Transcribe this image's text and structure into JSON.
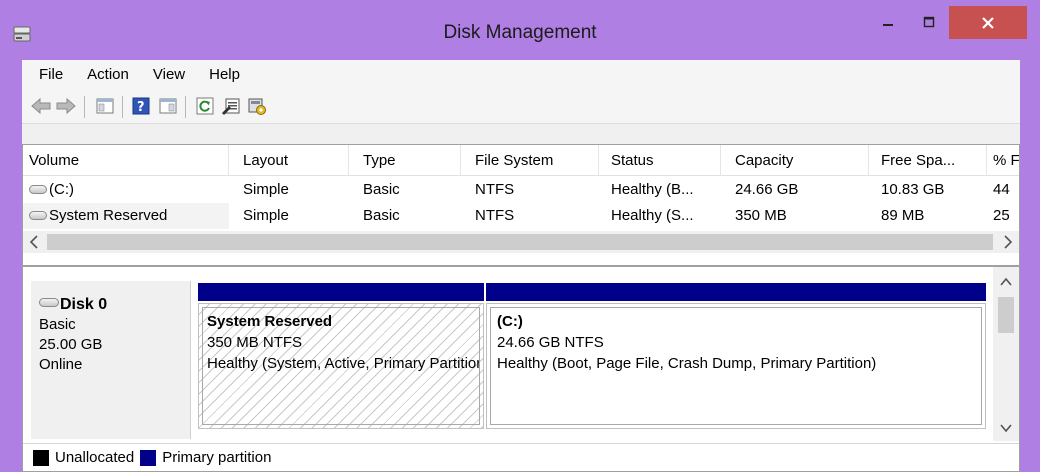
{
  "window": {
    "title": "Disk Management",
    "titlebar_color": "#b07fe3",
    "close_color": "#c75050"
  },
  "menu": [
    "File",
    "Action",
    "View",
    "Help"
  ],
  "toolbar": {
    "icons": [
      "back-arrow-icon",
      "forward-arrow-icon",
      "show-hide-console-tree-icon",
      "help-icon",
      "show-hide-action-pane-icon",
      "refresh-icon",
      "properties-icon",
      "disk-settings-icon"
    ]
  },
  "volume_list": {
    "columns": [
      "Volume",
      "Layout",
      "Type",
      "File System",
      "Status",
      "Capacity",
      "Free Spa...",
      "% F"
    ],
    "rows": [
      [
        "(C:)",
        "Simple",
        "Basic",
        "NTFS",
        "Healthy (B...",
        "24.66 GB",
        "10.83 GB",
        "44"
      ],
      [
        "System Reserved",
        "Simple",
        "Basic",
        "NTFS",
        "Healthy (S...",
        "350 MB",
        "89 MB",
        "25"
      ]
    ]
  },
  "disk": {
    "name": "Disk 0",
    "type": "Basic",
    "size": "25.00 GB",
    "state": "Online"
  },
  "partitions": [
    {
      "name": "System Reserved",
      "size_fs": "350 MB NTFS",
      "status": "Healthy (System, Active, Primary Partition)"
    },
    {
      "name": "(C:)",
      "size_fs": "24.66 GB NTFS",
      "status": "Healthy (Boot, Page File, Crash Dump, Primary Partition)"
    }
  ],
  "legend": [
    {
      "label": "Unallocated",
      "color": "#000000"
    },
    {
      "label": "Primary partition",
      "color": "#00008b"
    }
  ]
}
